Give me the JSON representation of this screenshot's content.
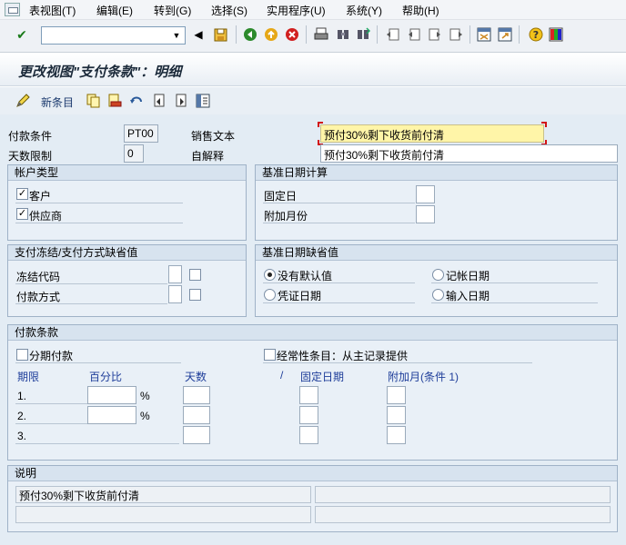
{
  "menu": {
    "items": [
      "表视图(T)",
      "编辑(E)",
      "转到(G)",
      "选择(S)",
      "实用程序(U)",
      "系统(Y)",
      "帮助(H)"
    ]
  },
  "toolbar": {
    "command_value": "",
    "icons": [
      "enter-icon",
      "back-arrow-icon",
      "save-icon",
      "back-icon",
      "exit-icon",
      "cancel-icon",
      "print-icon",
      "find-icon",
      "find-next-icon",
      "first-page-icon",
      "previous-page-icon",
      "next-page-icon",
      "last-page-icon",
      "new-session-icon",
      "shortcut-icon",
      "help-icon",
      "layout-icon"
    ]
  },
  "title": "更改视图\"支付条款\"：明细",
  "app_toolbar": {
    "new_entry": "新条目",
    "icons": [
      "change-display-icon",
      "copy-icon",
      "delete-icon",
      "undo-icon",
      "previous-entry-icon",
      "next-entry-icon",
      "variable-list-icon"
    ]
  },
  "header": {
    "payment_terms_label": "付款条件",
    "payment_terms_value": "PT00",
    "day_limit_label": "天数限制",
    "day_limit_value": "0",
    "sales_text_label": "销售文本",
    "sales_text_value": "预付30%剩下收货前付清",
    "own_explanation_label": "自解释",
    "own_explanation_value": "预付30%剩下收货前付清"
  },
  "account_type": {
    "title": "帐户类型",
    "customer_label": "客户",
    "customer_checked": true,
    "vendor_label": "供应商",
    "vendor_checked": true
  },
  "baseline_calc": {
    "title": "基准日期计算",
    "fixed_day_label": "固定日",
    "fixed_day_value": "",
    "additional_months_label": "附加月份",
    "additional_months_value": ""
  },
  "payment_block": {
    "title": "支付冻结/支付方式缺省值",
    "block_key_label": "冻结代码",
    "payment_method_label": "付款方式"
  },
  "baseline_default": {
    "title": "基准日期缺省值",
    "options": [
      "没有默认值",
      "记帐日期",
      "凭证日期",
      "输入日期"
    ],
    "selected": "没有默认值"
  },
  "payment_terms": {
    "title": "付款条款",
    "installment_label": "分期付款",
    "installment_checked": false,
    "recurring_label": "经常性条目：从主记录提供",
    "recurring_checked": false,
    "col_period": "期限",
    "col_percent": "百分比",
    "col_days": "天数",
    "col_slash": "/",
    "col_fixed_date": "固定日期",
    "col_add_month": "附加月(条件 1)",
    "rows": [
      {
        "label": "1.",
        "percent_sign": "%"
      },
      {
        "label": "2.",
        "percent_sign": "%"
      },
      {
        "label": "3.",
        "percent_sign": ""
      }
    ]
  },
  "explanation": {
    "title": "说明",
    "line1": "预付30%剩下收货前付清",
    "line2": "",
    "line3": "",
    "line4": ""
  }
}
